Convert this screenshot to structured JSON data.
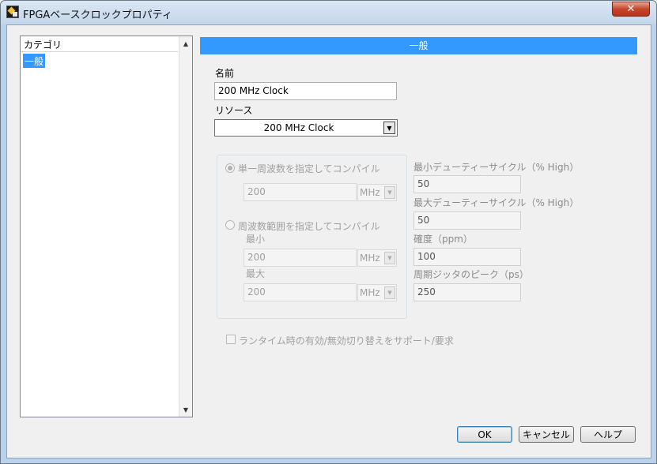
{
  "window": {
    "title": "FPGAベースクロックプロパティ",
    "close_symbol": "✕"
  },
  "categories": {
    "header": "カテゴリ",
    "items": [
      {
        "label": "一般",
        "selected": true
      }
    ]
  },
  "section_title": "一般",
  "name": {
    "label": "名前",
    "value": "200 MHz Clock"
  },
  "resource": {
    "label": "リソース",
    "value": "200 MHz Clock"
  },
  "compile_mode": {
    "single": {
      "label": "単一周波数を指定してコンパイル",
      "selected": true,
      "value": "200",
      "unit": "MHz"
    },
    "range": {
      "label": "周波数範囲を指定してコンパイル",
      "selected": false,
      "min_label": "最小",
      "min_value": "200",
      "min_unit": "MHz",
      "max_label": "最大",
      "max_value": "200",
      "max_unit": "MHz"
    }
  },
  "duty": {
    "min_label": "最小デューティーサイクル（% High）",
    "min_value": "50",
    "max_label": "最大デューティーサイクル（% High）",
    "max_value": "50"
  },
  "accuracy": {
    "label": "確度（ppm）",
    "value": "100"
  },
  "jitter": {
    "label": "周期ジッタのピーク（ps）",
    "value": "250"
  },
  "runtime_toggle": {
    "label": "ランタイム時の有効/無効切り替えをサポート/要求",
    "checked": false
  },
  "buttons": {
    "ok": "OK",
    "cancel": "キャンセル",
    "help": "ヘルプ"
  },
  "icons": {
    "app": "labview-fpga-icon",
    "dropdown": "▼",
    "scroll_up": "▲",
    "scroll_down": "▼"
  },
  "colors": {
    "accent": "#3399ff",
    "close": "#c7452a"
  }
}
